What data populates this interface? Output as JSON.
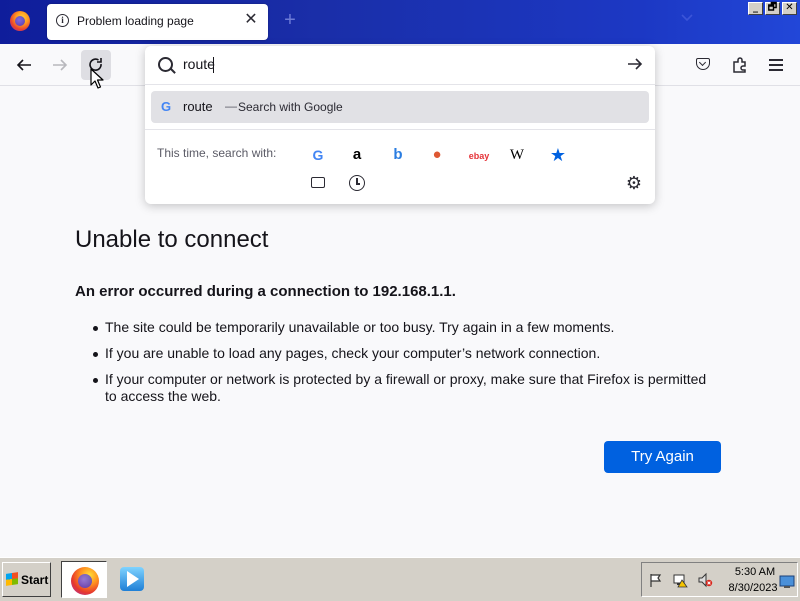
{
  "browser": {
    "tab": {
      "title": "Problem loading page"
    },
    "new_tab_symbol": "+",
    "window_controls": {
      "minimize": "_",
      "maximize": "🗗",
      "close": "✕"
    }
  },
  "urlbar": {
    "value": "route",
    "suggestion": {
      "term": "route",
      "separator": "—",
      "action": "Search with Google"
    },
    "one_off_label": "This time, search with:",
    "engines": [
      {
        "name": "google",
        "glyph": "G",
        "color": "#4285f4"
      },
      {
        "name": "amazon",
        "glyph": "a",
        "color": "#000000"
      },
      {
        "name": "bing",
        "glyph": "b",
        "color": "#2a7de1"
      },
      {
        "name": "duckduckgo",
        "glyph": "●",
        "color": "#de5833"
      },
      {
        "name": "ebay",
        "glyph": "ebay",
        "color": "#e53238"
      },
      {
        "name": "wikipedia",
        "glyph": "W",
        "color": "#000000"
      },
      {
        "name": "bookmarks",
        "glyph": "★",
        "color": "#0061e0"
      }
    ]
  },
  "error": {
    "title": "Unable to connect",
    "short_desc": "An error occurred during a connection to 192.168.1.1.",
    "items": [
      "The site could be temporarily unavailable or too busy. Try again in a few moments.",
      "If you are unable to load any pages, check your computer’s network connection.",
      "If your computer or network is protected by a firewall or proxy, make sure that Firefox is permitted to access the web."
    ],
    "button_label": "Try Again",
    "accent_color": "#0061e0"
  },
  "taskbar": {
    "start_label": "Start",
    "time": "5:30 AM",
    "date": "8/30/2023"
  }
}
